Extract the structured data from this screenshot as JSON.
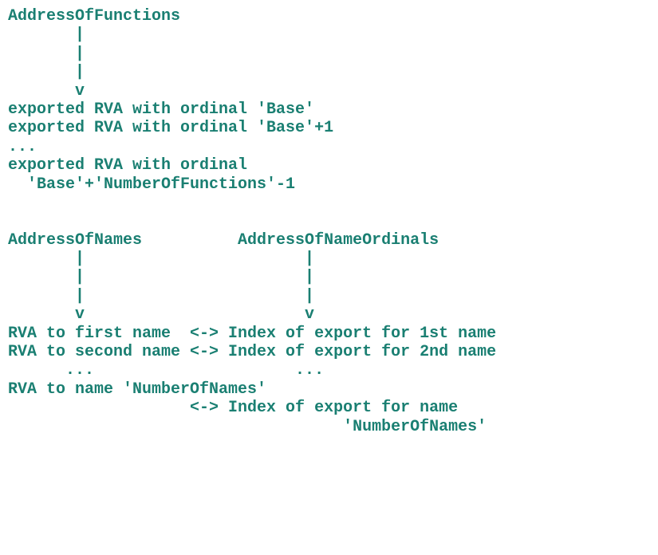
{
  "text_color": "#1a7f72",
  "lines": [
    "AddressOfFunctions",
    "       |",
    "       |",
    "       |",
    "       v",
    "exported RVA with ordinal 'Base'",
    "exported RVA with ordinal 'Base'+1",
    "...",
    "exported RVA with ordinal",
    "  'Base'+'NumberOfFunctions'-1",
    "",
    "",
    "AddressOfNames          AddressOfNameOrdinals",
    "       |                       |",
    "       |                       |",
    "       |                       |",
    "       v                       v",
    "RVA to first name  <-> Index of export for 1st name",
    "RVA to second name <-> Index of export for 2nd name",
    "      ...                     ...",
    "RVA to name 'NumberOfNames'",
    "                   <-> Index of export for name",
    "                                   'NumberOfNames'"
  ]
}
